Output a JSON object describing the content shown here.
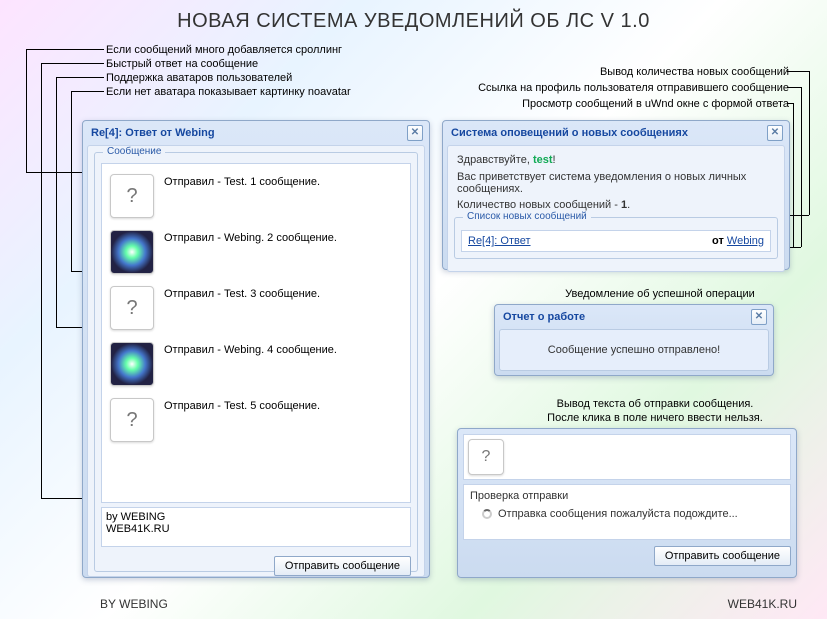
{
  "page_title": "НОВАЯ СИСТЕМА УВЕДОМЛЕНИЙ ОБ ЛС V 1.0",
  "annotations": {
    "a1": "Если сообщений много добавляется сроллинг",
    "a2": "Быстрый ответ на сообщение",
    "a3": "Поддержка аватаров пользователей",
    "a4": "Если нет аватара показывает картинку noavatar",
    "a5": "Вывод количества новых сообщений",
    "a6": "Ссылка на профиль пользователя отправившего сообщение",
    "a7": "Просмотр сообщений в uWnd окне с формой ответа",
    "a8": "Уведомление об успешной операции",
    "a9": "Вывод текста об отправки сообщения.",
    "a10": "После клика в поле ничего ввести нельзя."
  },
  "left_window": {
    "title": "Re[4]: Ответ от Webing",
    "group_label": "Сообщение",
    "messages": [
      {
        "avatar": "noavatar",
        "text": "Отправил - Test. 1 сообщение."
      },
      {
        "avatar": "img",
        "text": "Отправил - Webing. 2 сообщение."
      },
      {
        "avatar": "noavatar",
        "text": "Отправил - Test. 3 сообщение."
      },
      {
        "avatar": "img",
        "text": "Отправил - Webing. 4 сообщение."
      },
      {
        "avatar": "noavatar",
        "text": "Отправил - Test. 5 сообщение."
      }
    ],
    "reply_text": "by WEBING\nWEB41K.RU",
    "send_btn": "Отправить сообщение"
  },
  "notify_window": {
    "title": "Система оповещений о новых сообщениях",
    "greeting_prefix": "Здравствуйте, ",
    "greeting_user": "test",
    "greeting_suffix": "!",
    "welcome": "Вас приветствует система уведомления о новых личных сообщениях.",
    "count_label": "Количество новых сообщений - ",
    "count_value": "1",
    "count_suffix": ".",
    "list_label": "Список новых сообщений",
    "msg_subject": "Re[4]: Ответ",
    "msg_from_label": "от ",
    "msg_from_user": "Webing"
  },
  "report_window": {
    "title": "Отчет о работе",
    "body": "Сообщение успешно отправлено!"
  },
  "sending_window": {
    "check_label": "Проверка отправки",
    "status": "Отправка сообщения пожалуйста подождите...",
    "send_btn": "Отправить сообщение"
  },
  "footer": {
    "left": "BY WEBING",
    "right": "WEB41K.RU"
  },
  "glyphs": {
    "close": "✕",
    "noavatar": "?"
  }
}
